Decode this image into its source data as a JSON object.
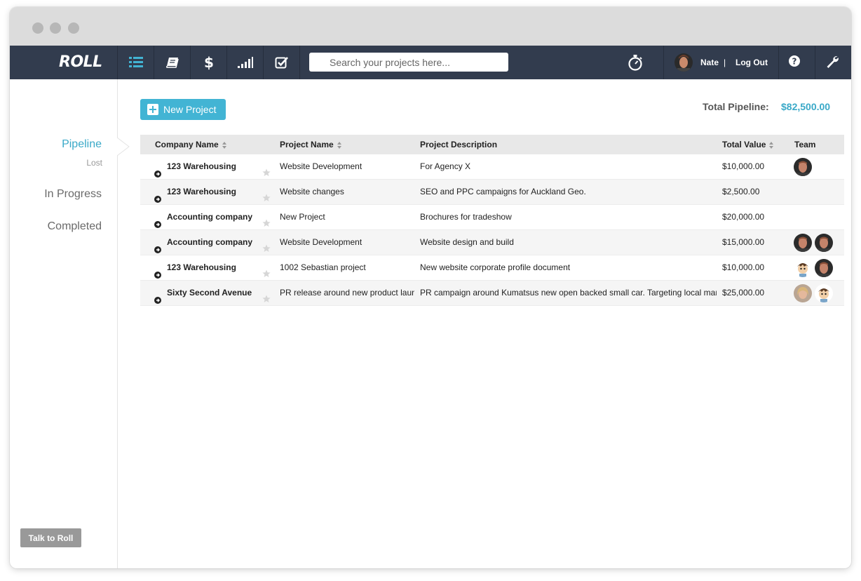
{
  "app": {
    "logo": "ROLL"
  },
  "nav": {
    "icons": [
      "list-icon",
      "book-icon",
      "dollar-icon",
      "signal-bars-icon",
      "checkbox-icon",
      "stopwatch-icon",
      "help-icon",
      "wrench-icon"
    ],
    "search_placeholder": "Search your projects here...",
    "user_name": "Nate",
    "separator": "|",
    "logout_label": "Log Out"
  },
  "sidebar": {
    "items": [
      {
        "label": "Pipeline",
        "active": true
      },
      {
        "label": "Lost"
      },
      {
        "label": "In Progress"
      },
      {
        "label": "Completed"
      }
    ],
    "talk_button": "Talk to Roll"
  },
  "main": {
    "new_project_label": "New Project",
    "total_pipeline_label": "Total Pipeline:",
    "total_pipeline_value": "$82,500.00"
  },
  "table": {
    "headers": [
      "Company Name",
      "Project Name",
      "Project Description",
      "Total Value",
      "Team"
    ],
    "rows": [
      {
        "company": "123 Warehousing",
        "project": "Website Development",
        "description": "For Agency X",
        "value": "$10,000.00",
        "team": [
          "dark"
        ]
      },
      {
        "company": "123 Warehousing",
        "project": "Website changes",
        "description": "SEO and PPC campaigns for Auckland Geo.",
        "value": "$2,500.00",
        "team": []
      },
      {
        "company": "Accounting company",
        "project": "New Project",
        "description": "Brochures for tradeshow",
        "value": "$20,000.00",
        "team": []
      },
      {
        "company": "Accounting company",
        "project": "Website Development",
        "description": "Website design and build",
        "value": "$15,000.00",
        "team": [
          "dark",
          "dark"
        ]
      },
      {
        "company": "123 Warehousing",
        "project": "1002 Sebastian project",
        "description": "New website corporate profile document",
        "value": "$10,000.00",
        "team": [
          "cartoon",
          "dark"
        ]
      },
      {
        "company": "Sixty Second Avenue",
        "project": "PR release around new product launch",
        "description": "PR campaign around Kumatsus new open backed small car. Targeting local market",
        "value": "$25,000.00",
        "team": [
          "blonde",
          "cartoon"
        ]
      }
    ]
  },
  "colors": {
    "navbar": "#323c4e",
    "accent": "#42b4d4",
    "link": "#3aa9c8"
  }
}
